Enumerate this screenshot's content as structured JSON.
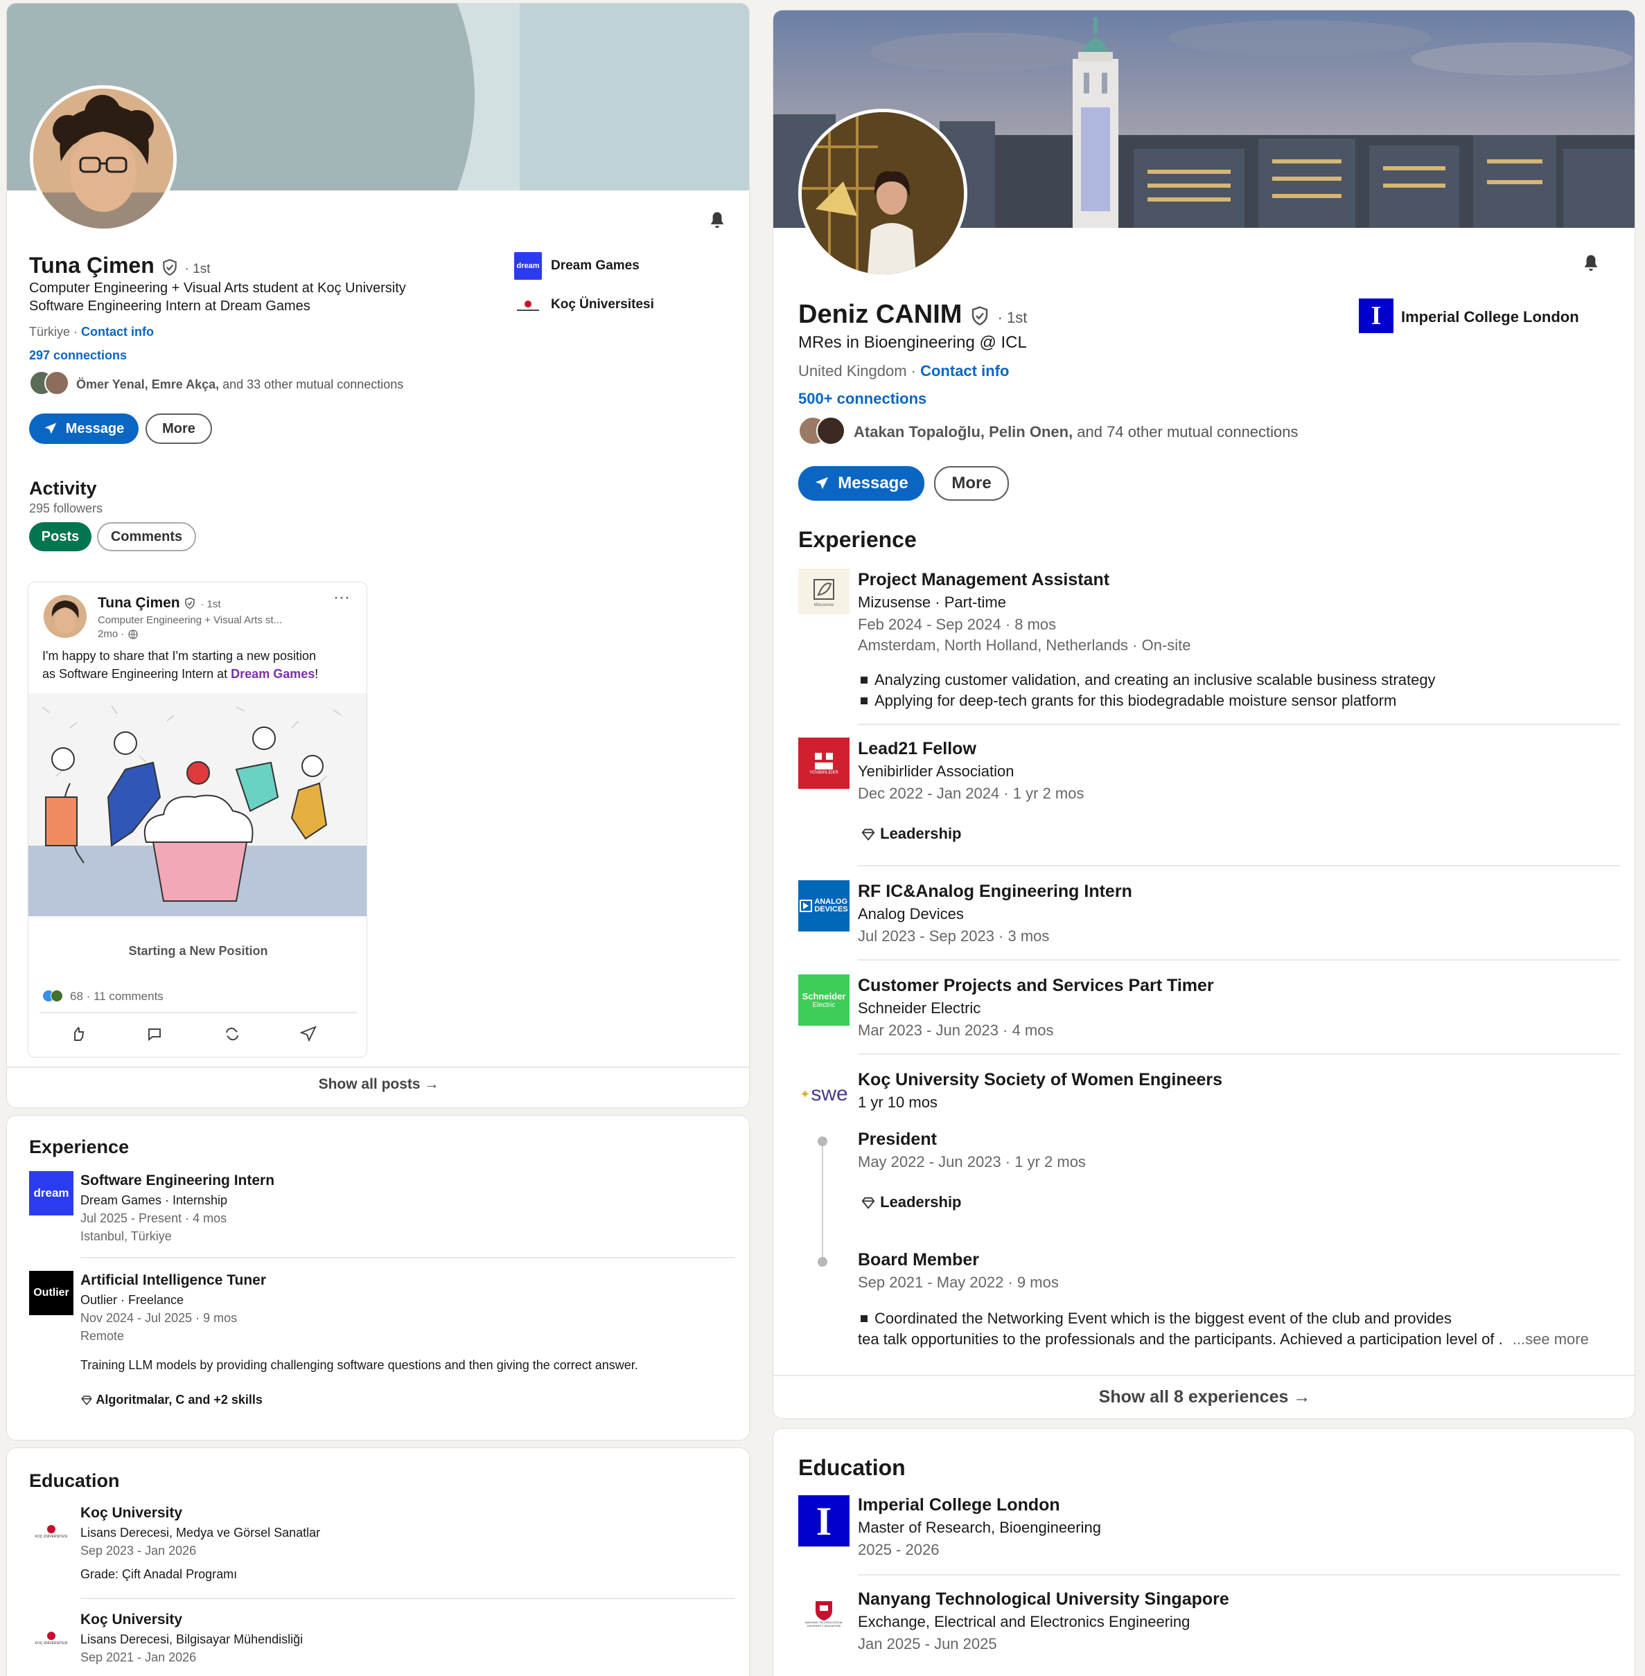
{
  "left": {
    "profile": {
      "name": "Tuna Çimen",
      "degree": "· 1st",
      "headline_1": "Computer Engineering + Visual Arts student at Koç University",
      "headline_2": "Software Engineering Intern at Dream Games",
      "location": "Türkiye",
      "sep": " · ",
      "contact_info": "Contact info",
      "connections": "297 connections",
      "mutual_names": "Ömer Yenal, Emre Akça,",
      "mutual_rest": " and 33 other mutual connections",
      "message_label": "Message",
      "more_label": "More",
      "company_1": "Dream Games",
      "company_2": "Koç Üniversitesi",
      "dream_logo_text": "dream"
    },
    "activity": {
      "title": "Activity",
      "followers": "295 followers",
      "tab_posts": "Posts",
      "tab_comments": "Comments",
      "post": {
        "author": "Tuna Çimen",
        "degree": "· 1st",
        "subtitle": "Computer Engineering + Visual Arts st...",
        "time": "2mo ·",
        "text_1": "I'm happy to share that I'm starting a new position",
        "text_2_pre": "as Software Engineering Intern at ",
        "text_2_link": "Dream Games",
        "text_2_post": "!",
        "image_caption": "Starting a New Position",
        "reactions": "68 · 11 comments",
        "more_dots": "···"
      },
      "show_all": "Show all posts →"
    },
    "experience": {
      "title": "Experience",
      "items": [
        {
          "title": "Software Engineering Intern",
          "company": "Dream Games · Internship",
          "dates": "Jul 2025 - Present · 4 mos",
          "location": "Istanbul, Türkiye",
          "logo_text": "dream"
        },
        {
          "title": "Artificial Intelligence Tuner",
          "company": "Outlier · Freelance",
          "dates": "Nov 2024 - Jul 2025 · 9 mos",
          "location": "Remote",
          "logo_text": "Outlier",
          "description": "Training LLM models by providing challenging software questions and then giving the correct answer.",
          "skills": "Algoritmalar, C and +2 skills"
        }
      ]
    },
    "education": {
      "title": "Education",
      "items": [
        {
          "school": "Koç University",
          "degree": "Lisans Derecesi, Medya ve Görsel Sanatlar",
          "dates": "Sep 2023 - Jan 2026",
          "grade": "Grade: Çift Anadal Programı",
          "logo_text": "KOÇ ÜNİVERSİTESİ"
        },
        {
          "school": "Koç University",
          "degree": "Lisans Derecesi, Bilgisayar Mühendisliği",
          "dates": "Sep 2021 - Jan 2026",
          "logo_text": "KOÇ ÜNİVERSİTESİ"
        }
      ]
    }
  },
  "right": {
    "profile": {
      "name": "Deniz CANIM",
      "degree": "· 1st",
      "headline": "MRes in Bioengineering @ ICL",
      "location": "United Kingdom",
      "sep": " · ",
      "contact_info": "Contact info",
      "connections": "500+ connections",
      "mutual_names": "Atakan Topaloğlu, Pelin Onen,",
      "mutual_rest": " and 74 other mutual connections",
      "message_label": "Message",
      "more_label": "More",
      "company": "Imperial College London",
      "icl_logo": "I"
    },
    "experience": {
      "title": "Experience",
      "items": [
        {
          "title": "Project Management Assistant",
          "company": "Mizusense · Part-time",
          "dates": "Feb 2024 - Sep 2024 · 8 mos",
          "location": "Amsterdam, North Holland, Netherlands · On-site",
          "bullet_1": "Analyzing customer validation, and creating an inclusive scalable business strategy",
          "bullet_2": "Applying for deep-tech grants for this biodegradable moisture sensor platform",
          "logo_text": "Mizusense"
        },
        {
          "title": "Lead21 Fellow",
          "company": "Yenibirlider Association",
          "dates": "Dec 2022 - Jan 2024 · 1 yr 2 mos",
          "skill": "Leadership",
          "logo_text": "YENİBİRLİDER"
        },
        {
          "title": "RF IC&Analog Engineering Intern",
          "company": "Analog Devices",
          "dates": "Jul 2023 - Sep 2023 · 3 mos",
          "logo_text_1": "ANALOG",
          "logo_text_2": "DEVICES"
        },
        {
          "title": "Customer Projects and Services Part Timer",
          "company": "Schneider Electric",
          "dates": "Mar 2023 - Jun 2023 · 4 mos",
          "logo_text_1": "Schneider",
          "logo_text_2": "Electric"
        },
        {
          "title": "Koç University Society of Women Engineers",
          "duration": "1 yr 10 mos",
          "logo_text": "swe",
          "roles": [
            {
              "title": "President",
              "dates": "May 2022 - Jun 2023 · 1 yr 2 mos",
              "skill": "Leadership"
            },
            {
              "title": "Board Member",
              "dates": "Sep 2021 - May 2022 · 9 mos",
              "bullet_1": "Coordinated the Networking Event which is the biggest event of the club and provides",
              "line_2": "tea talk opportunities to the professionals and the participants. Achieved a participation level of .",
              "see_more": "...see more"
            }
          ]
        }
      ],
      "show_all": "Show all 8 experiences →"
    },
    "education": {
      "title": "Education",
      "items": [
        {
          "school": "Imperial College London",
          "degree": "Master of Research, Bioengineering",
          "dates": "2025 - 2026",
          "logo_text": "I"
        },
        {
          "school": "Nanyang Technological University Singapore",
          "degree": "Exchange, Electrical and Electronics Engineering",
          "dates": "Jan 2025 - Jun 2025",
          "logo_text": "NANYANG TECHNOLOGICAL UNIVERSITY SINGAPORE"
        }
      ]
    }
  },
  "colors": {
    "link": "#0a66c2",
    "posts_tab": "#01754f",
    "dream_logo": "#2b3bf0",
    "icl_blue": "#0000cd",
    "yenibirlider_red": "#d01f2e",
    "analog_blue": "#0067b9",
    "schneider_green": "#3dcd58",
    "link_purple": "#7b2fa8"
  }
}
